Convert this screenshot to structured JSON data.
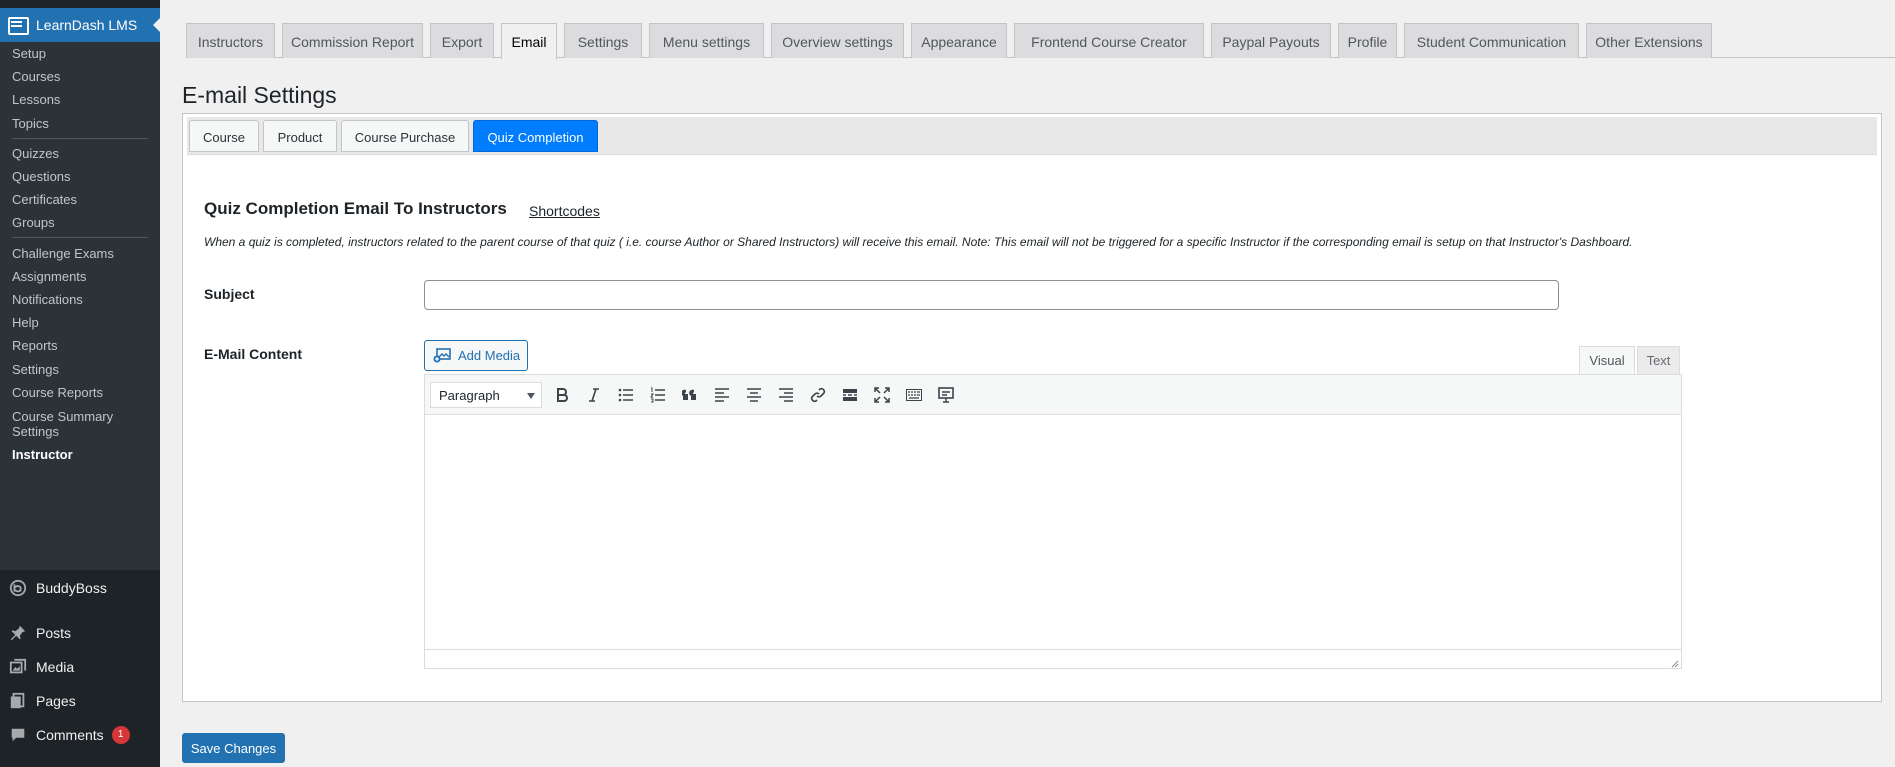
{
  "sidebar": {
    "plugin_title": "LearnDash LMS",
    "submenu": [
      "Setup",
      "Courses",
      "Lessons",
      "Topics",
      "Quizzes",
      "Questions",
      "Certificates",
      "Groups",
      "Challenge Exams",
      "Assignments",
      "Notifications",
      "Help",
      "Reports",
      "Settings",
      "Course Reports",
      "Course Summary",
      "Settings",
      "Instructor"
    ],
    "menu": {
      "buddyboss": "BuddyBoss",
      "posts": "Posts",
      "media": "Media",
      "pages": "Pages",
      "comments": "Comments",
      "comments_badge": "1"
    }
  },
  "nav_tabs": [
    "Instructors",
    "Commission Report",
    "Export",
    "Email",
    "Settings",
    "Menu settings",
    "Overview settings",
    "Appearance",
    "Frontend Course Creator",
    "Paypal Payouts",
    "Profile",
    "Student Communication",
    "Other Extensions"
  ],
  "page_title": "E-mail Settings",
  "sub_tabs": [
    "Course",
    "Product",
    "Course Purchase",
    "Quiz Completion"
  ],
  "section": {
    "heading": "Quiz Completion Email To Instructors",
    "shortcodes_link": "Shortcodes",
    "description": "When a quiz is completed, instructors related to the parent course of that quiz ( i.e. course Author or Shared Instructors) will receive this email. Note: This email will not be triggered for a specific Instructor if the corresponding email is setup on that Instructor's Dashboard."
  },
  "form": {
    "subject_label": "Subject",
    "subject_value": "",
    "content_label": "E-Mail Content",
    "add_media": "Add Media",
    "tab_visual": "Visual",
    "tab_text": "Text",
    "format_select": "Paragraph"
  },
  "toolbar_icons": [
    "bold-icon",
    "italic-icon",
    "bullet-list-icon",
    "numbered-list-icon",
    "blockquote-icon",
    "align-left-icon",
    "align-center-icon",
    "align-right-icon",
    "link-icon",
    "read-more-icon",
    "fullscreen-icon",
    "toolbar-toggle-icon",
    "monitor-icon"
  ],
  "save_button": "Save Changes",
  "colors": {
    "sidebar_bg": "#1d2327",
    "submenu_bg": "#2c3338",
    "accent": "#2271b1",
    "active_subtab": "#007cff",
    "badge": "#d63638"
  }
}
